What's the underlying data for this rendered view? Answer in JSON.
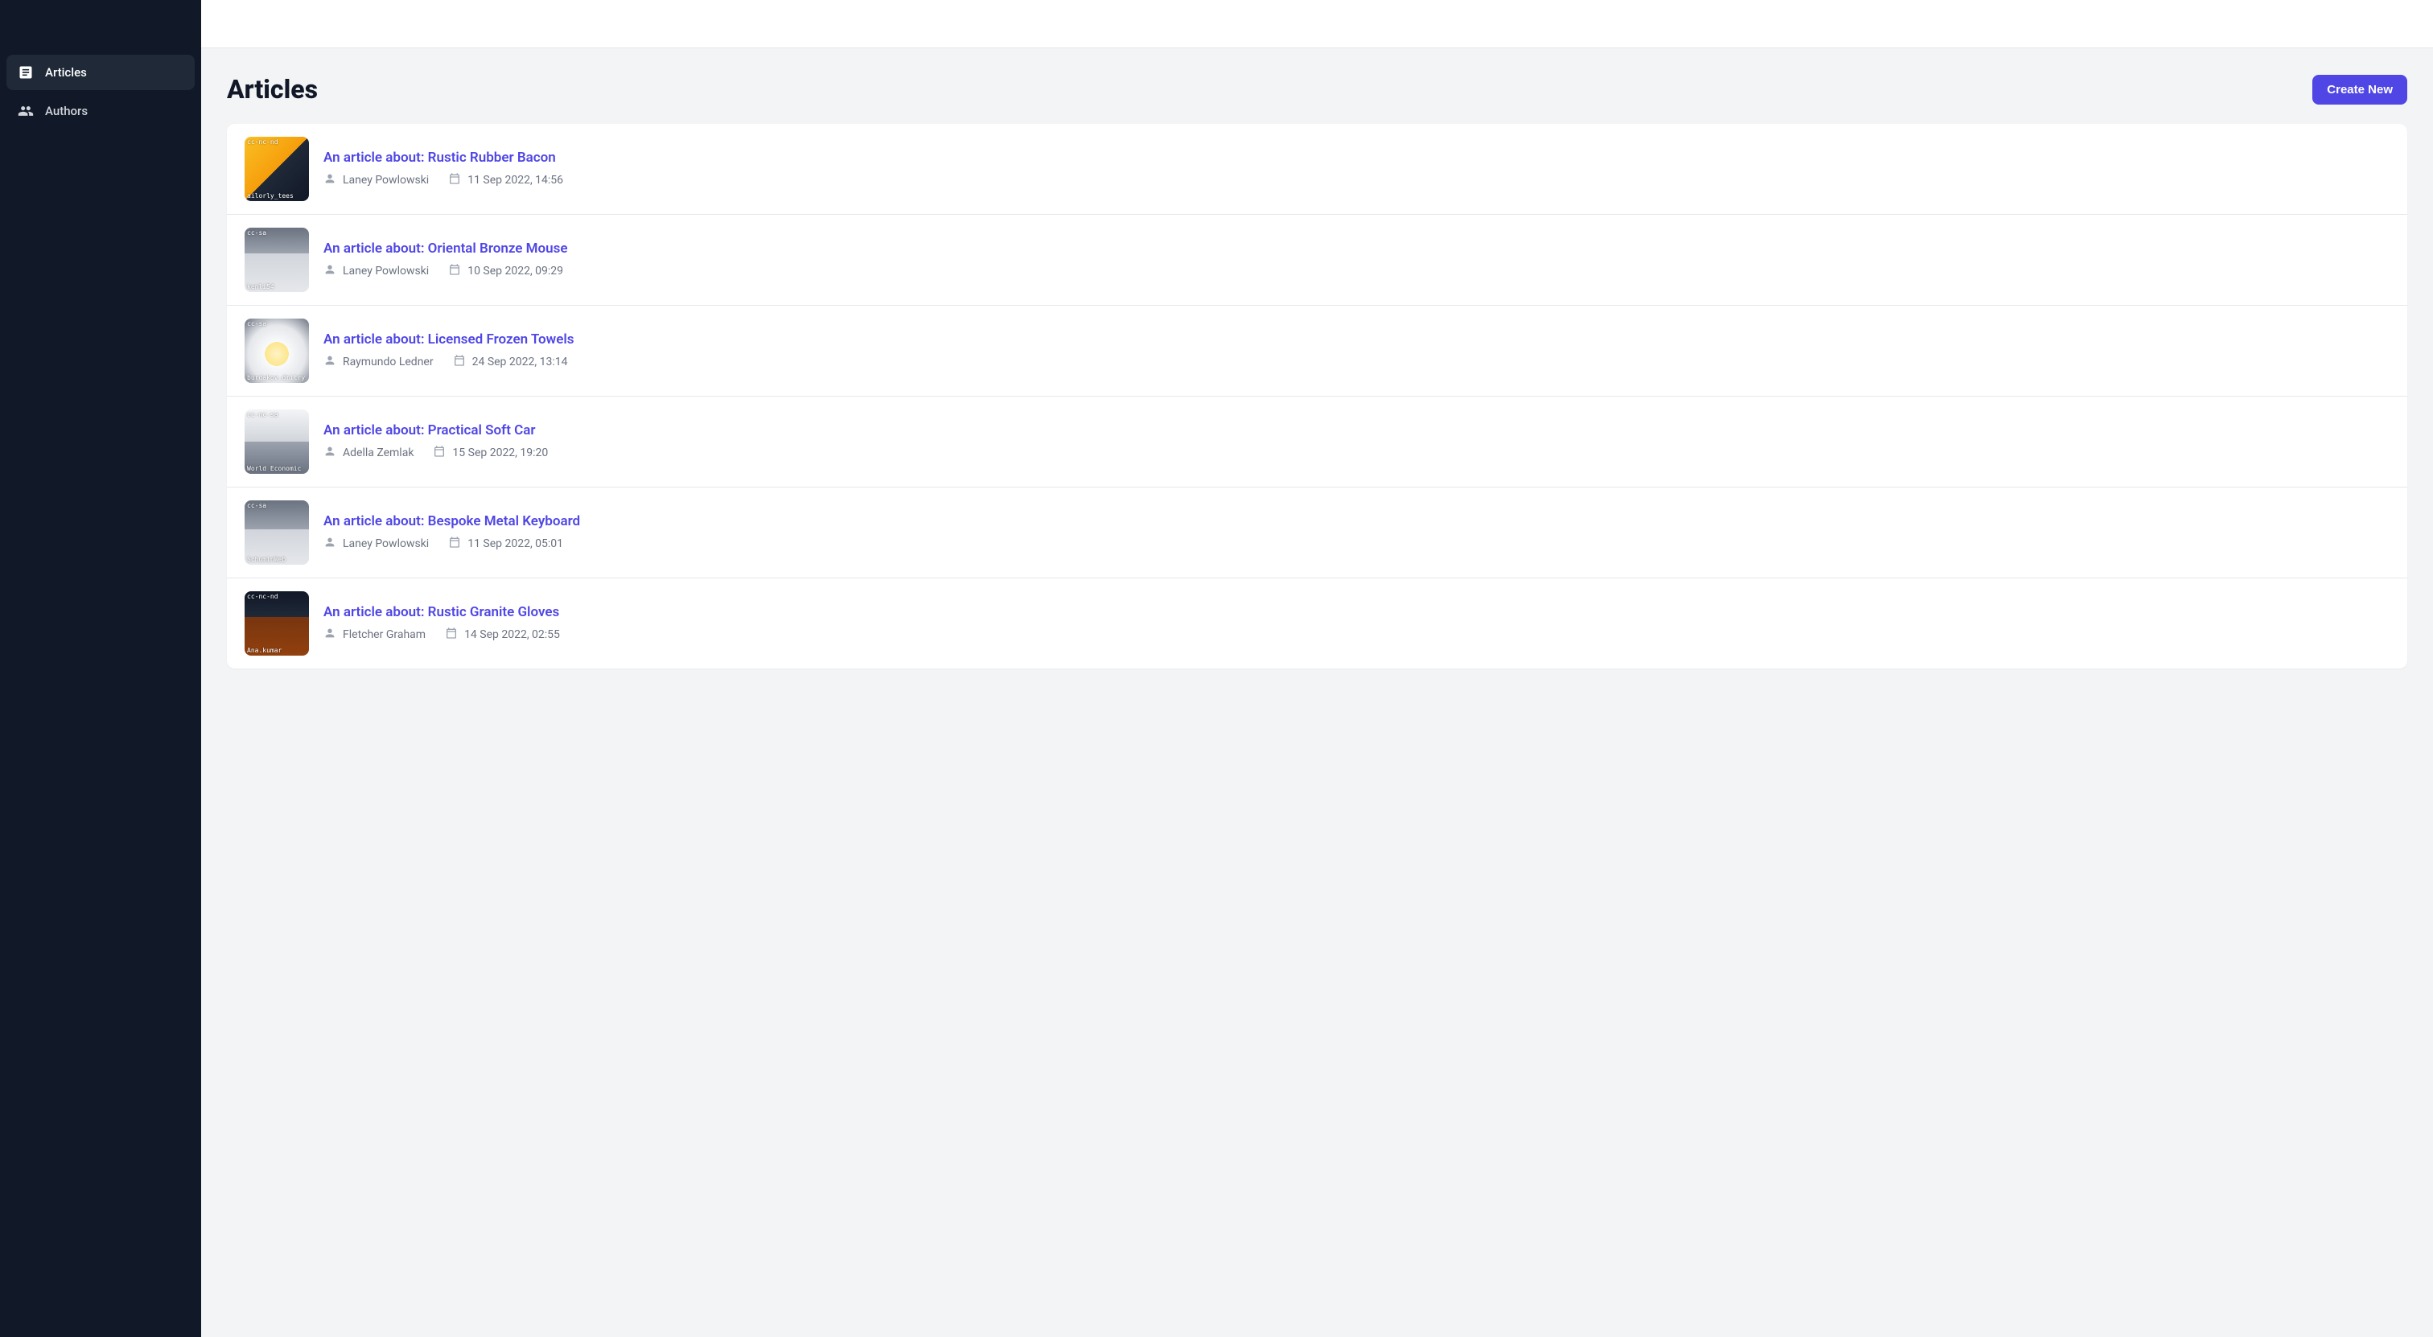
{
  "sidebar": {
    "items": [
      {
        "label": "Articles"
      },
      {
        "label": "Authors"
      }
    ]
  },
  "page": {
    "title": "Articles",
    "create_label": "Create New"
  },
  "articles": [
    {
      "title": "An article about: Rustic Rubber Bacon",
      "author": "Laney Powlowski",
      "date": "11 Sep 2022, 14:56",
      "thumb_top": "cc-nc-nd",
      "thumb_bottom": "ailorly_tees"
    },
    {
      "title": "An article about: Oriental Bronze Mouse",
      "author": "Laney Powlowski",
      "date": "10 Sep 2022, 09:29",
      "thumb_top": "cc-sa",
      "thumb_bottom": "kenli54"
    },
    {
      "title": "An article about: Licensed Frozen Towels",
      "author": "Raymundo Ledner",
      "date": "24 Sep 2022, 13:14",
      "thumb_top": "cc-sa",
      "thumb_bottom": "burdakov.dmitry"
    },
    {
      "title": "An article about: Practical Soft Car",
      "author": "Adella Zemlak",
      "date": "15 Sep 2022, 19:20",
      "thumb_top": "cc-nc-sa",
      "thumb_bottom": "World Economic"
    },
    {
      "title": "An article about: Bespoke Metal Keyboard",
      "author": "Laney Powlowski",
      "date": "11 Sep 2022, 05:01",
      "thumb_top": "cc-sa",
      "thumb_bottom": "SchuminWeb"
    },
    {
      "title": "An article about: Rustic Granite Gloves",
      "author": "Fletcher Graham",
      "date": "14 Sep 2022, 02:55",
      "thumb_top": "cc-nc-nd",
      "thumb_bottom": "Ana.kumar"
    }
  ]
}
